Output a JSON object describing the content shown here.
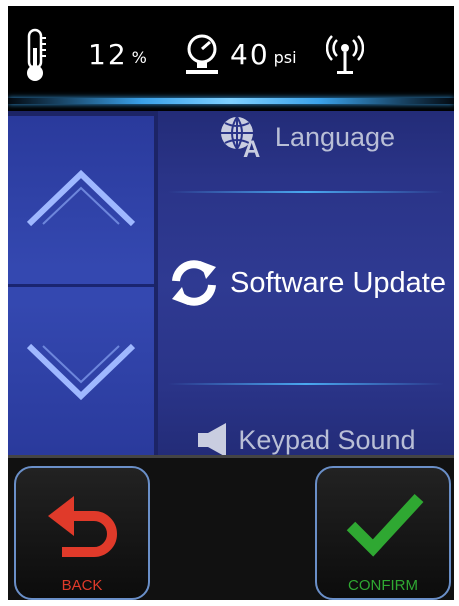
{
  "status": {
    "humidity_value": "12",
    "humidity_unit": "%",
    "pressure_value": "40",
    "pressure_unit": "psi"
  },
  "menu": {
    "items": [
      {
        "label": "Language",
        "icon": "globe-language-icon"
      },
      {
        "label": "Software Update",
        "icon": "refresh-icon"
      },
      {
        "label": "Keypad Sound",
        "icon": "speaker-icon"
      }
    ],
    "selected": "Software Update"
  },
  "buttons": {
    "back_label": "BACK",
    "confirm_label": "CONFIRM"
  },
  "colors": {
    "back": "#e03a2a",
    "confirm": "#2fa832",
    "accent": "#3aa0e8"
  }
}
